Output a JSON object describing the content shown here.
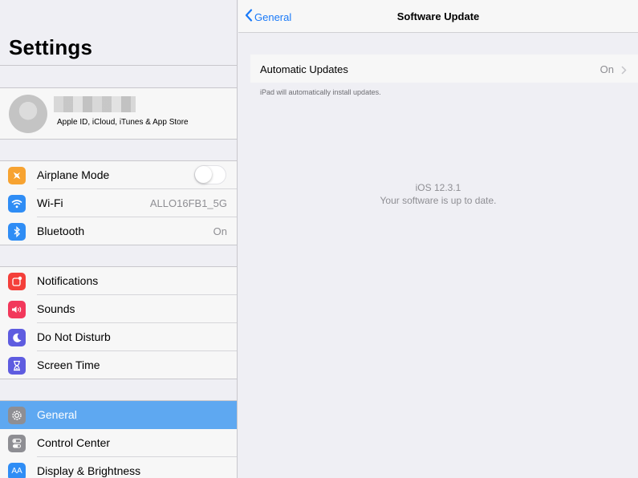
{
  "sidebar": {
    "title": "Settings",
    "profile": {
      "subtitle": "Apple ID, iCloud, iTunes & App Store"
    },
    "groups": [
      {
        "items": [
          {
            "label": "Airplane Mode",
            "icon": "airplane-icon",
            "color": "#f7a331",
            "control": "toggle",
            "toggle_on": false
          },
          {
            "label": "Wi-Fi",
            "icon": "wifi-icon",
            "color": "#2f8df5",
            "value": "ALLO16FB1_5G"
          },
          {
            "label": "Bluetooth",
            "icon": "bluetooth-icon",
            "color": "#2f8df5",
            "value": "On"
          }
        ]
      },
      {
        "items": [
          {
            "label": "Notifications",
            "icon": "notifications-icon",
            "color": "#f43f3a"
          },
          {
            "label": "Sounds",
            "icon": "sounds-icon",
            "color": "#f2385b"
          },
          {
            "label": "Do Not Disturb",
            "icon": "moon-icon",
            "color": "#5e5ce0"
          },
          {
            "label": "Screen Time",
            "icon": "hourglass-icon",
            "color": "#5e5ce0"
          }
        ]
      },
      {
        "items": [
          {
            "label": "General",
            "icon": "gear-icon",
            "color": "#8e8e93",
            "selected": true
          },
          {
            "label": "Control Center",
            "icon": "toggles-icon",
            "color": "#8e8e93"
          },
          {
            "label": "Display & Brightness",
            "icon": "display-icon",
            "color": "#2f8df5",
            "icon_text": "AA"
          }
        ]
      }
    ]
  },
  "main": {
    "back_label": "General",
    "title": "Software Update",
    "automatic_updates": {
      "label": "Automatic Updates",
      "value": "On",
      "footnote": "iPad will automatically install updates."
    },
    "status": {
      "version": "iOS 12.3.1",
      "message": "Your software is up to date."
    }
  },
  "colors": {
    "accent": "#1a7af8",
    "selected_row": "#5ea8f1",
    "background": "#efeff4"
  }
}
